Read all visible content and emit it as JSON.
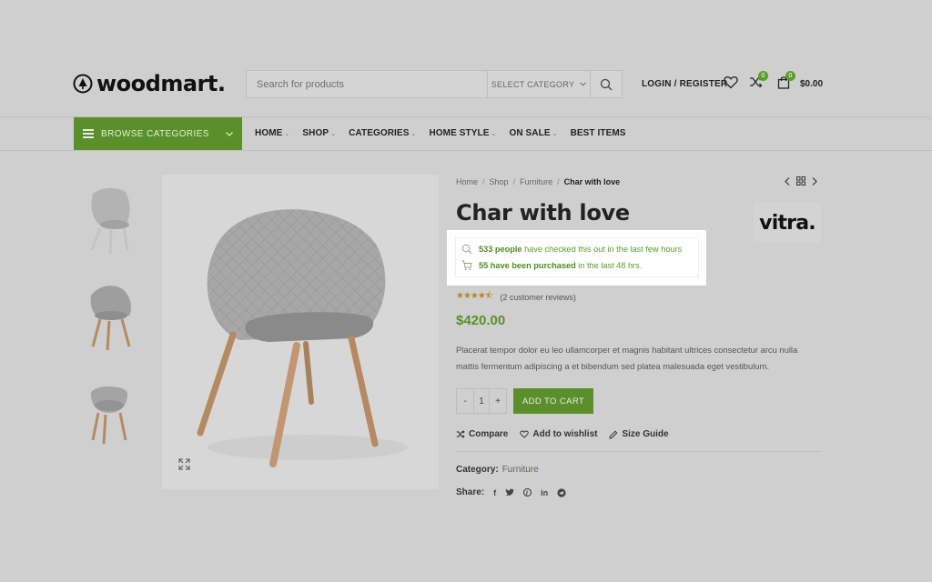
{
  "header": {
    "logo_text": "woodmart.",
    "search_placeholder": "Search for products",
    "select_category": "SELECT CATEGORY",
    "login_label": "LOGIN / REGISTER",
    "wishlist_count": "0",
    "compare_count": "0",
    "cart_count": "0",
    "cart_total": "$0.00"
  },
  "nav": {
    "browse_label": "BROWSE CATEGORIES",
    "items": [
      {
        "label": "HOME",
        "dropdown": true
      },
      {
        "label": "SHOP",
        "dropdown": true
      },
      {
        "label": "CATEGORIES",
        "dropdown": true
      },
      {
        "label": "HOME STYLE",
        "dropdown": true
      },
      {
        "label": "ON SALE",
        "dropdown": true
      },
      {
        "label": "BEST ITEMS",
        "dropdown": false
      }
    ]
  },
  "breadcrumb": [
    "Home",
    "Shop",
    "Furniture",
    "Char with love"
  ],
  "product": {
    "title": "Char with love",
    "brand": "vitra.",
    "visits_count": "533 people",
    "visits_text": "have checked this out in the last few hours",
    "purchased_count": "55 have been purchased",
    "purchased_text": "in the last 48 hrs.",
    "rating": 4.5,
    "reviews": "(2 customer reviews)",
    "price": "$420.00",
    "description": "Placerat tempor dolor eu leo ullamcorper et magnis habitant ultrices consectetur arcu nulla mattis fermentum adipiscing a et bibendum sed platea malesuada eget vestibulum.",
    "qty_minus": "-",
    "qty_value": "1",
    "qty_plus": "+",
    "add_to_cart": "ADD TO CART",
    "compare": "Compare",
    "wishlist": "Add to wishlist",
    "size_guide": "Size Guide",
    "category_label": "Category:",
    "category_value": "Furniture",
    "share_label": "Share:",
    "share_icons": [
      "f",
      "t",
      "p",
      "in",
      "tg"
    ]
  },
  "colors": {
    "accent": "#5a8f2c",
    "highlight_text": "#4d8c1e",
    "overlay": "#cfcfcf"
  }
}
